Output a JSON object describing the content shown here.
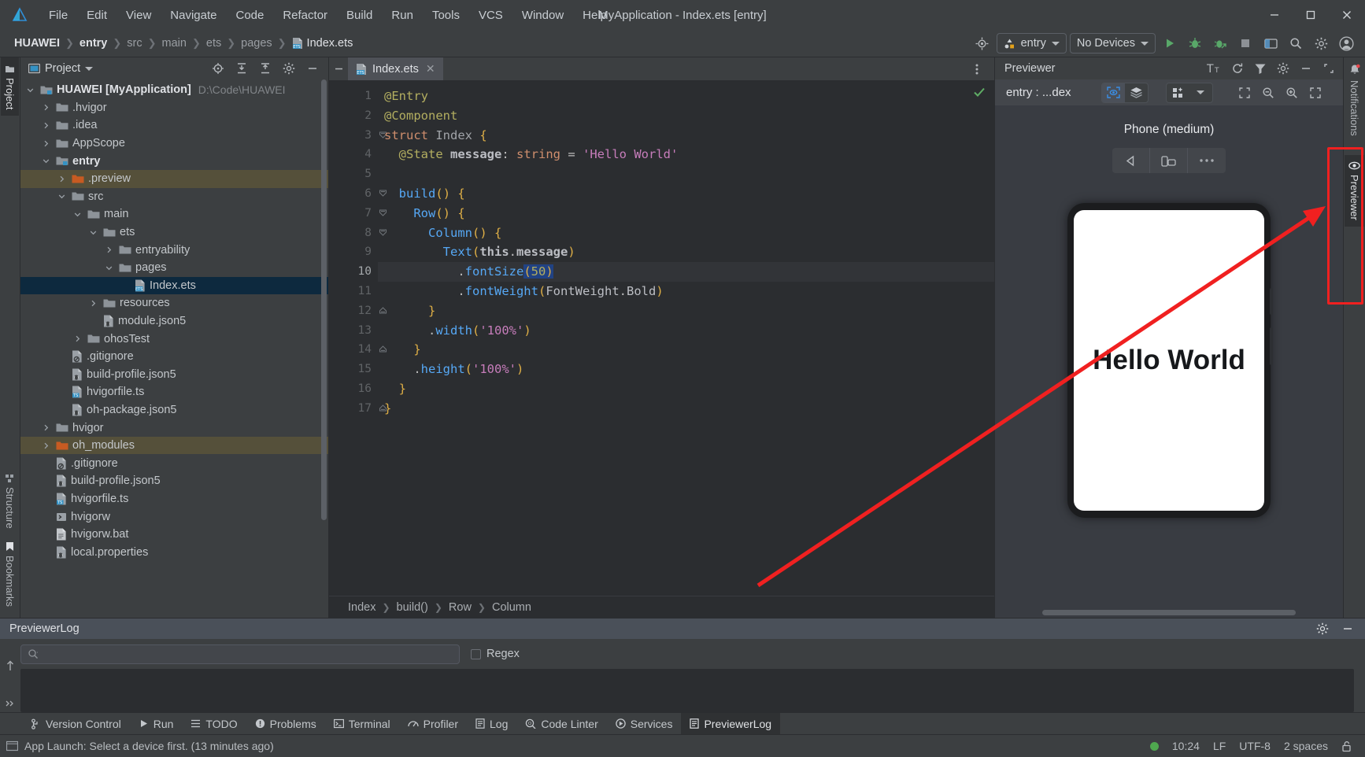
{
  "window": {
    "title": "MyApplication - Index.ets [entry]",
    "logo_icon": "huawei-devEco-logo-icon",
    "minimize_label": "—",
    "maximize_label": "☐",
    "close_label": "✕"
  },
  "menubar": [
    {
      "label": "File"
    },
    {
      "label": "Edit"
    },
    {
      "label": "View"
    },
    {
      "label": "Navigate"
    },
    {
      "label": "Code"
    },
    {
      "label": "Refactor"
    },
    {
      "label": "Build"
    },
    {
      "label": "Run"
    },
    {
      "label": "Tools"
    },
    {
      "label": "VCS"
    },
    {
      "label": "Window"
    },
    {
      "label": "Help"
    }
  ],
  "breadcrumbs": [
    {
      "label": "HUAWEI",
      "bold": true
    },
    {
      "label": "entry",
      "bold": true
    },
    {
      "label": "src",
      "bold": false
    },
    {
      "label": "main",
      "bold": false
    },
    {
      "label": "ets",
      "bold": false
    },
    {
      "label": "pages",
      "bold": false
    },
    {
      "label": "Index.ets",
      "bold": false
    }
  ],
  "toolbar": {
    "target_icon": "target-selector-icon",
    "run_config_label": "entry",
    "run_config_icon": "module-icon",
    "device_label": "No Devices",
    "run_icon": "run-play-icon",
    "debug_icon": "debug-bug-icon",
    "attach_icon": "attach-debugger-icon",
    "stop_icon": "stop-icon",
    "layout_icon": "layout-inspector-icon",
    "search_icon": "search-everywhere-icon",
    "settings_icon": "settings-gear-icon",
    "account_icon": "user-account-icon"
  },
  "left_rail": {
    "tabs": [
      {
        "label": "Project",
        "icon": "project-folder-icon",
        "active": true
      }
    ],
    "bottom_tabs": [
      {
        "label": "Structure",
        "icon": "structure-icon"
      },
      {
        "label": "Bookmarks",
        "icon": "bookmark-icon"
      }
    ]
  },
  "project_panel": {
    "title": "Project",
    "title_icon": "project-view-icon",
    "dropdown_icon": "chevron-down-icon",
    "actions": [
      {
        "icon": "scroll-from-source-icon"
      },
      {
        "icon": "expand-all-icon"
      },
      {
        "icon": "collapse-all-icon"
      },
      {
        "icon": "options-gear-icon"
      },
      {
        "icon": "hide-panel-icon"
      }
    ],
    "tree": [
      {
        "depth": 0,
        "arrow": "down",
        "icon": "module-folder-icon",
        "label": "HUAWEI [MyApplication]",
        "bold": true,
        "path": "D:\\Code\\HUAWEI",
        "state": "normal"
      },
      {
        "depth": 1,
        "arrow": "right",
        "icon": "folder-icon",
        "label": ".hvigor",
        "bold": false,
        "path": "",
        "state": "normal"
      },
      {
        "depth": 1,
        "arrow": "right",
        "icon": "folder-icon",
        "label": ".idea",
        "bold": false,
        "path": "",
        "state": "normal"
      },
      {
        "depth": 1,
        "arrow": "right",
        "icon": "folder-icon",
        "label": "AppScope",
        "bold": false,
        "path": "",
        "state": "normal"
      },
      {
        "depth": 1,
        "arrow": "down",
        "icon": "module-folder-icon",
        "label": "entry",
        "bold": true,
        "path": "",
        "state": "normal"
      },
      {
        "depth": 2,
        "arrow": "right",
        "icon": "folder-orange-icon",
        "label": ".preview",
        "bold": false,
        "path": "",
        "state": "hl"
      },
      {
        "depth": 2,
        "arrow": "down",
        "icon": "folder-icon",
        "label": "src",
        "bold": false,
        "path": "",
        "state": "normal"
      },
      {
        "depth": 3,
        "arrow": "down",
        "icon": "folder-icon",
        "label": "main",
        "bold": false,
        "path": "",
        "state": "normal"
      },
      {
        "depth": 4,
        "arrow": "down",
        "icon": "folder-icon",
        "label": "ets",
        "bold": false,
        "path": "",
        "state": "normal"
      },
      {
        "depth": 5,
        "arrow": "right",
        "icon": "folder-icon",
        "label": "entryability",
        "bold": false,
        "path": "",
        "state": "normal"
      },
      {
        "depth": 5,
        "arrow": "down",
        "icon": "folder-icon",
        "label": "pages",
        "bold": false,
        "path": "",
        "state": "normal"
      },
      {
        "depth": 6,
        "arrow": "none",
        "icon": "ets-file-icon",
        "label": "Index.ets",
        "bold": false,
        "path": "",
        "state": "selected"
      },
      {
        "depth": 4,
        "arrow": "right",
        "icon": "folder-icon",
        "label": "resources",
        "bold": false,
        "path": "",
        "state": "normal"
      },
      {
        "depth": 4,
        "arrow": "none",
        "icon": "json5-file-icon",
        "label": "module.json5",
        "bold": false,
        "path": "",
        "state": "normal"
      },
      {
        "depth": 3,
        "arrow": "right",
        "icon": "folder-icon",
        "label": "ohosTest",
        "bold": false,
        "path": "",
        "state": "normal"
      },
      {
        "depth": 2,
        "arrow": "none",
        "icon": "gitignore-file-icon",
        "label": ".gitignore",
        "bold": false,
        "path": "",
        "state": "normal"
      },
      {
        "depth": 2,
        "arrow": "none",
        "icon": "json5-file-icon",
        "label": "build-profile.json5",
        "bold": false,
        "path": "",
        "state": "normal"
      },
      {
        "depth": 2,
        "arrow": "none",
        "icon": "ts-file-icon",
        "label": "hvigorfile.ts",
        "bold": false,
        "path": "",
        "state": "normal"
      },
      {
        "depth": 2,
        "arrow": "none",
        "icon": "json5-file-icon",
        "label": "oh-package.json5",
        "bold": false,
        "path": "",
        "state": "normal"
      },
      {
        "depth": 1,
        "arrow": "right",
        "icon": "folder-icon",
        "label": "hvigor",
        "bold": false,
        "path": "",
        "state": "normal"
      },
      {
        "depth": 1,
        "arrow": "right",
        "icon": "folder-orange-icon",
        "label": "oh_modules",
        "bold": false,
        "path": "",
        "state": "hl"
      },
      {
        "depth": 1,
        "arrow": "none",
        "icon": "gitignore-file-icon",
        "label": ".gitignore",
        "bold": false,
        "path": "",
        "state": "normal"
      },
      {
        "depth": 1,
        "arrow": "none",
        "icon": "json5-file-icon",
        "label": "build-profile.json5",
        "bold": false,
        "path": "",
        "state": "normal"
      },
      {
        "depth": 1,
        "arrow": "none",
        "icon": "ts-file-icon",
        "label": "hvigorfile.ts",
        "bold": false,
        "path": "",
        "state": "normal"
      },
      {
        "depth": 1,
        "arrow": "none",
        "icon": "bat-exec-icon",
        "label": "hvigorw",
        "bold": false,
        "path": "",
        "state": "normal"
      },
      {
        "depth": 1,
        "arrow": "none",
        "icon": "bat-file-icon",
        "label": "hvigorw.bat",
        "bold": false,
        "path": "",
        "state": "normal"
      },
      {
        "depth": 1,
        "arrow": "none",
        "icon": "json5-file-icon",
        "label": "local.properties",
        "bold": false,
        "path": "",
        "state": "cut"
      }
    ]
  },
  "editor": {
    "tab": {
      "label": "Index.ets",
      "icon": "ets-file-icon",
      "close_icon": "close-icon"
    },
    "collapse_icon": "collapse-editor-icon",
    "more_icon": "more-vertical-icon",
    "inspection_icon": "inspection-ok-check-icon",
    "lines": [
      {
        "n": 1,
        "fold": "none",
        "current": false,
        "bulb": false
      },
      {
        "n": 2,
        "fold": "none",
        "current": false,
        "bulb": false
      },
      {
        "n": 3,
        "fold": "open",
        "current": false,
        "bulb": false
      },
      {
        "n": 4,
        "fold": "none",
        "current": false,
        "bulb": false
      },
      {
        "n": 5,
        "fold": "none",
        "current": false,
        "bulb": false
      },
      {
        "n": 6,
        "fold": "open",
        "current": false,
        "bulb": false
      },
      {
        "n": 7,
        "fold": "open",
        "current": false,
        "bulb": false
      },
      {
        "n": 8,
        "fold": "open",
        "current": false,
        "bulb": false
      },
      {
        "n": 9,
        "fold": "none",
        "current": false,
        "bulb": false
      },
      {
        "n": 10,
        "fold": "none",
        "current": true,
        "bulb": true
      },
      {
        "n": 11,
        "fold": "none",
        "current": false,
        "bulb": false
      },
      {
        "n": 12,
        "fold": "close",
        "current": false,
        "bulb": false
      },
      {
        "n": 13,
        "fold": "none",
        "current": false,
        "bulb": false
      },
      {
        "n": 14,
        "fold": "close",
        "current": false,
        "bulb": false
      },
      {
        "n": 15,
        "fold": "none",
        "current": false,
        "bulb": false
      },
      {
        "n": 16,
        "fold": "none",
        "current": false,
        "bulb": false
      },
      {
        "n": 17,
        "fold": "close",
        "current": false,
        "bulb": false
      }
    ],
    "source_lines": [
      "@Entry",
      "@Component",
      "struct Index {",
      "  @State message: string = 'Hello World'",
      "",
      "  build() {",
      "    Row() {",
      "      Column() {",
      "        Text(this.message)",
      "          .fontSize(50)",
      "          .fontWeight(FontWeight.Bold)",
      "      }",
      "      .width('100%')",
      "    }",
      "    .height('100%')",
      "  }",
      "}"
    ],
    "status_breadcrumb": [
      "Index",
      "build()",
      "Row",
      "Column"
    ]
  },
  "previewer": {
    "title": "Previewer",
    "header_actions": [
      {
        "icon": "font-size-Tt-icon"
      },
      {
        "icon": "refresh-icon"
      },
      {
        "icon": "filter-funnel-icon"
      },
      {
        "icon": "settings-gear-icon"
      },
      {
        "icon": "minimize-icon"
      },
      {
        "icon": "hide-panel-icon"
      }
    ],
    "target_label": "entry : ...dex",
    "sub_actions": [
      {
        "icon": "inspector-eye-icon",
        "on": true
      },
      {
        "icon": "layers-icon",
        "on": false
      },
      {
        "icon": "multi-device-grid-icon",
        "on": false
      },
      {
        "icon": "chevron-down-icon",
        "on": false
      },
      {
        "icon": "fit-screen-icon",
        "on": false
      },
      {
        "icon": "zoom-out-icon",
        "on": false
      },
      {
        "icon": "zoom-in-icon",
        "on": false
      },
      {
        "icon": "expand-arrows-icon",
        "on": false
      }
    ],
    "device_name": "Phone (medium)",
    "device_controls": [
      {
        "icon": "rotate-back-triangle-icon"
      },
      {
        "icon": "rotate-device-icon"
      },
      {
        "icon": "more-dots-icon"
      }
    ],
    "screen_text": "Hello World"
  },
  "right_rail": {
    "tabs": [
      {
        "label": "Notifications",
        "icon": "notification-bell-icon",
        "badge": true,
        "active": false
      },
      {
        "label": "Previewer",
        "icon": "previewer-eye-icon",
        "badge": false,
        "active": true
      }
    ]
  },
  "log_panel": {
    "title": "PreviewerLog",
    "settings_icon": "settings-gear-icon",
    "minimize_icon": "minimize-icon",
    "search_placeholder": "",
    "search_icon": "search-icon",
    "search_value": "",
    "regex_label": "Regex",
    "regex_checked": false,
    "side_icons": [
      {
        "icon": "scroll-up-arrow-icon"
      },
      {
        "icon": "expand-chevrons-icon"
      }
    ]
  },
  "status_tabs": [
    {
      "label": "Version Control",
      "icon": "branch-icon",
      "active": false
    },
    {
      "label": "Run",
      "icon": "run-play-icon",
      "active": false
    },
    {
      "label": "TODO",
      "icon": "todo-list-icon",
      "active": false
    },
    {
      "label": "Problems",
      "icon": "problems-warning-icon",
      "active": false
    },
    {
      "label": "Terminal",
      "icon": "terminal-icon",
      "active": false
    },
    {
      "label": "Profiler",
      "icon": "profiler-graph-icon",
      "active": false
    },
    {
      "label": "Log",
      "icon": "log-icon",
      "active": false
    },
    {
      "label": "Code Linter",
      "icon": "code-linter-icon",
      "active": false
    },
    {
      "label": "Services",
      "icon": "services-icon",
      "active": false
    },
    {
      "label": "PreviewerLog",
      "icon": "previewer-log-icon",
      "active": true
    }
  ],
  "statusbar": {
    "message_icon": "event-log-icon",
    "message": "App Launch: Select a device first. (13 minutes ago)",
    "indicator_color": "#4fa84f",
    "time": "10:24",
    "line_sep": "LF",
    "encoding": "UTF-8",
    "indent": "2 spaces",
    "lock_icon": "unlocked-icon"
  },
  "annotation": {
    "arrow_color": "#f02020",
    "box_color": "#f02020"
  }
}
